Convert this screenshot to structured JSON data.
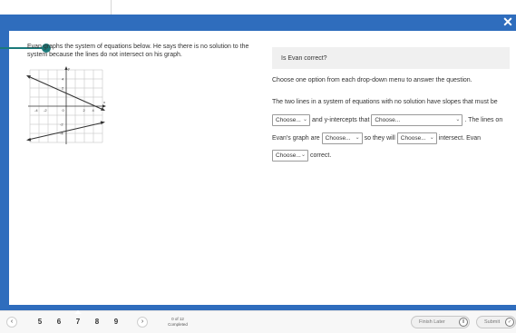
{
  "window": {
    "close_symbol": "✕"
  },
  "question": {
    "prompt": "Evan graphs the system of equations below. He says there is no solution to the system because the lines do not intersect on his graph.",
    "ask": "Is Evan correct?",
    "instruction": "Choose one option from each drop-down menu to answer the question.",
    "sentence_1": "The two lines in a system of equations with no solution have slopes that must be",
    "and_text": "and",
    "intercepts_text": "y-intercepts that",
    "lines_on_text": ". The lines on",
    "evans_graph_text": "Evan's graph are",
    "so_they_will_text": "so they will",
    "intersect_text": "intersect. Evan",
    "correct_text": "correct.",
    "dropdown_placeholder": "Choose..."
  },
  "graph": {
    "x_ticks": [
      "-4",
      "-2",
      "0",
      "2",
      "4"
    ],
    "y_ticks": [
      "4",
      "2",
      "-2",
      "-4"
    ],
    "x_axis_label": "x",
    "y_axis_label": "y"
  },
  "navigation": {
    "prev_icon": "chevron-left-icon",
    "next_icon": "chevron-right-icon",
    "question_numbers": [
      "5",
      "6",
      "7",
      "8",
      "9"
    ],
    "current_question": "7",
    "progress_count": "0 of 12",
    "progress_label": "Completed",
    "finish_later_label": "Finish Later",
    "submit_label": "Submit"
  },
  "colors": {
    "stage_blue": "#2f6dbd",
    "pointer_teal": "#1b7a7a"
  }
}
